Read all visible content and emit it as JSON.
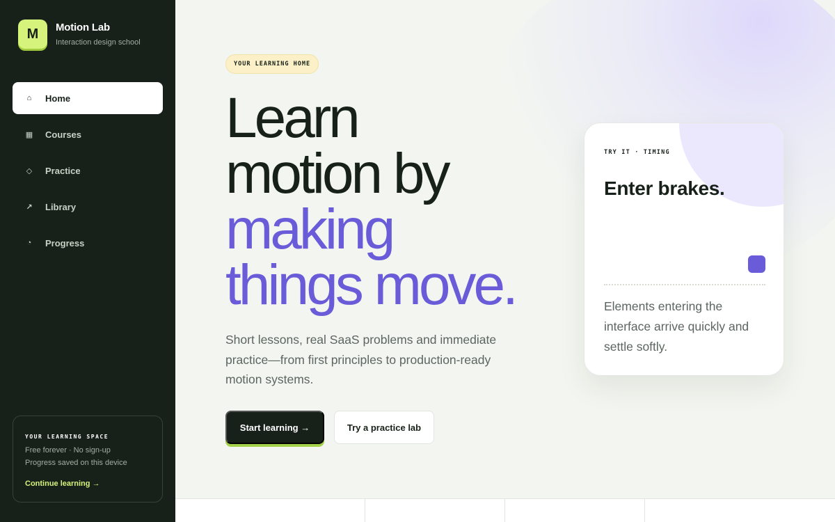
{
  "brand": {
    "logo_letter": "M",
    "name": "Motion Lab",
    "tagline": "Interaction design school"
  },
  "sidebar": {
    "items": [
      {
        "label": "Home",
        "icon": "home-icon",
        "glyph": "⌂",
        "active": true
      },
      {
        "label": "Courses",
        "icon": "grid-icon",
        "glyph": "▦",
        "active": false
      },
      {
        "label": "Practice",
        "icon": "diamond-icon",
        "glyph": "◇",
        "active": false
      },
      {
        "label": "Library",
        "icon": "arrow-up-right-icon",
        "glyph": "↗",
        "active": false
      },
      {
        "label": "Progress",
        "icon": "pie-chart-icon",
        "glyph": "◔",
        "active": false
      }
    ],
    "space_card": {
      "title": "YOUR LEARNING SPACE",
      "line1": "Free forever · No sign-up",
      "line2": "Progress saved on this device",
      "link": "Continue learning →"
    }
  },
  "hero": {
    "eyebrow": "YOUR LEARNING HOME",
    "headline": {
      "line1": "Learn",
      "line2": "motion by",
      "line3": "making",
      "line4": "things move."
    },
    "lede": "Short lessons, real SaaS problems and immediate practice—from first principles to production-ready motion systems.",
    "primary_cta": "Start learning →",
    "secondary_cta": "Try a practice lab"
  },
  "demo_card": {
    "tag": "TRY IT · TIMING",
    "title": "Enter brakes.",
    "body": "Elements entering the interface arrive quickly and settle softly."
  },
  "colors": {
    "sidebar_bg": "#172119",
    "accent_lime": "#d6f47c",
    "accent_purple": "#6a5cd8",
    "page_bg": "#f3f6f0"
  }
}
